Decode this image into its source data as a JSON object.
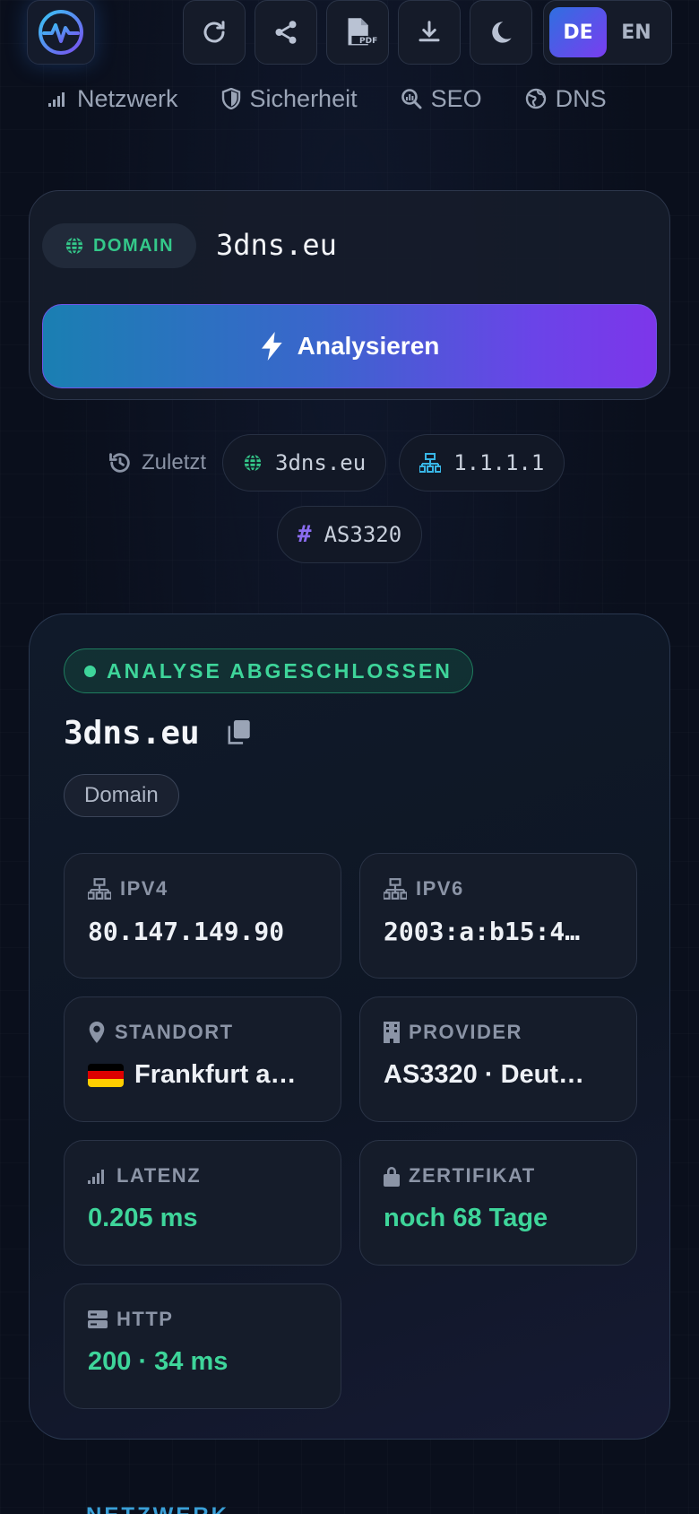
{
  "toolbar": {
    "logo_icon": "pulse-logo-icon",
    "buttons": [
      {
        "name": "reload",
        "icon": "refresh-icon"
      },
      {
        "name": "share",
        "icon": "share-icon"
      },
      {
        "name": "pdf",
        "icon": "pdf-file-icon",
        "label": "PDF"
      },
      {
        "name": "download",
        "icon": "download-icon"
      },
      {
        "name": "theme",
        "icon": "moon-icon"
      }
    ],
    "lang_active": "DE",
    "lang_other": "EN"
  },
  "nav": [
    {
      "label": "Netzwerk",
      "icon": "signal-bars-icon"
    },
    {
      "label": "Sicherheit",
      "icon": "shield-icon"
    },
    {
      "label": "SEO",
      "icon": "search-chart-icon"
    },
    {
      "label": "DNS",
      "icon": "globe-icon"
    }
  ],
  "search": {
    "type_label": "DOMAIN",
    "value": "3dns.eu",
    "analyze_label": "Analysieren"
  },
  "recent": {
    "label": "Zuletzt",
    "items": [
      {
        "label": "3dns.eu",
        "icon": "globe-icon",
        "color": "#34c88a"
      },
      {
        "label": "1.1.1.1",
        "icon": "network-icon",
        "color": "#38b6e6"
      },
      {
        "label": "AS3320",
        "icon": "hash-icon",
        "color": "#8a6cf0"
      }
    ]
  },
  "result": {
    "status": "ANALYSE ABGESCHLOSSEN",
    "title": "3dns.eu",
    "type": "Domain",
    "tiles": {
      "ipv4": {
        "label": "IPV4",
        "value": "80.147.149.90"
      },
      "ipv6": {
        "label": "IPV6",
        "value": "2003:a:b15:4…"
      },
      "location": {
        "label": "STANDORT",
        "value": "Frankfurt a…"
      },
      "provider": {
        "label": "PROVIDER",
        "value": "AS3320 · Deut…"
      },
      "latency": {
        "label": "LATENZ",
        "value": "0.205 ms"
      },
      "certificate": {
        "label": "ZERTIFIKAT",
        "value": "noch 68 Tage"
      },
      "http": {
        "label": "HTTP",
        "value": "200 · 34 ms"
      }
    }
  },
  "next_section": "NETZWERK",
  "colors": {
    "accent_green": "#3ed59a",
    "accent_blue": "#1a7fb2",
    "accent_purple": "#7d36ea",
    "background": "#0a0f1c"
  }
}
